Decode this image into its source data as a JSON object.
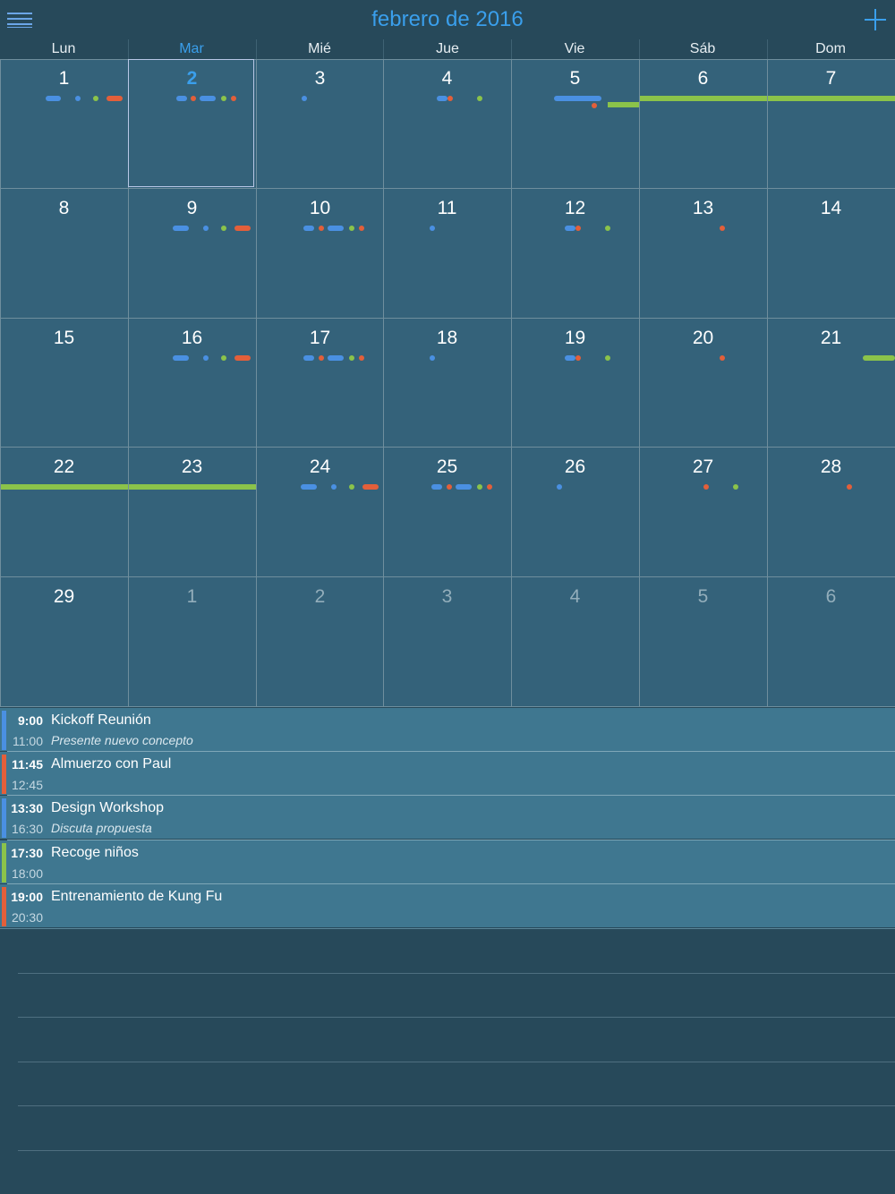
{
  "header": {
    "title": "febrero de 2016"
  },
  "weekdays": [
    "Lun",
    "Mar",
    "Mié",
    "Jue",
    "Vie",
    "Sáb",
    "Dom"
  ],
  "calendar": {
    "days": [
      "1",
      "2",
      "3",
      "4",
      "5",
      "6",
      "7",
      "8",
      "9",
      "10",
      "11",
      "12",
      "13",
      "14",
      "15",
      "16",
      "17",
      "18",
      "19",
      "20",
      "21",
      "22",
      "23",
      "24",
      "25",
      "26",
      "27",
      "28",
      "29",
      "1",
      "2",
      "3",
      "4",
      "5",
      "6"
    ]
  },
  "colors": {
    "blue": "#4a90e2",
    "red": "#e35f3a",
    "green": "#8bc34a",
    "accent": "#3a9fec"
  },
  "events": [
    {
      "start": "9:00",
      "end": "11:00",
      "name": "Kickoff Reunión",
      "note": "Presente nuevo concepto",
      "color": "blue"
    },
    {
      "start": "11:45",
      "end": "12:45",
      "name": "Almuerzo con Paul",
      "note": "",
      "color": "red"
    },
    {
      "start": "13:30",
      "end": "16:30",
      "name": "Design Workshop",
      "note": "Discuta propuesta",
      "color": "blue"
    },
    {
      "start": "17:30",
      "end": "18:00",
      "name": "Recoge niños",
      "note": "",
      "color": "green"
    },
    {
      "start": "19:00",
      "end": "20:30",
      "name": "Entrenamiento de Kung Fu",
      "note": "",
      "color": "red"
    }
  ]
}
